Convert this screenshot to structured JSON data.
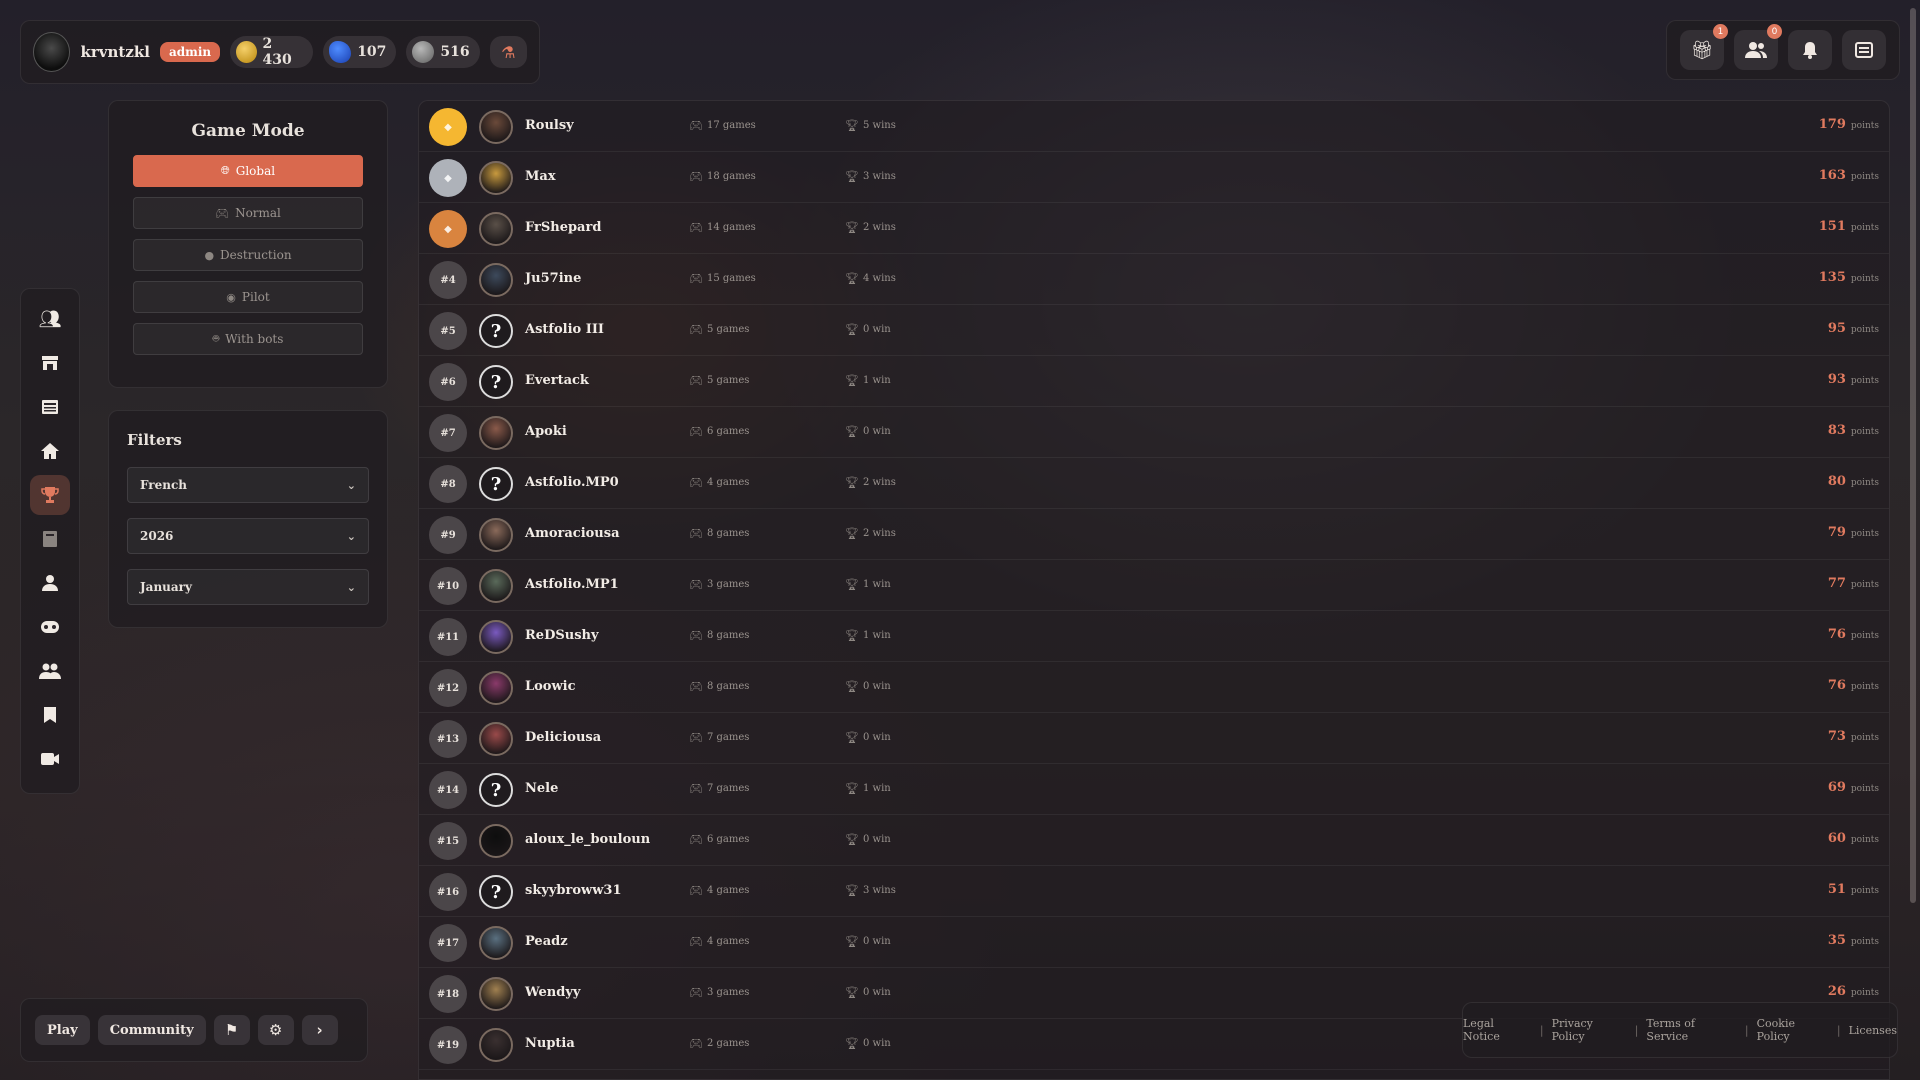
{
  "user": {
    "name": "krvntzkl",
    "role": "admin",
    "gold": "2 430",
    "gems": "107",
    "silver": "516"
  },
  "topright": {
    "gift_badge": "1",
    "friends_badge": "0"
  },
  "sidebar": {
    "items": [
      "friends-icon",
      "shop-icon",
      "news-icon",
      "home-icon",
      "trophy-icon",
      "book-icon",
      "user-icon",
      "gamepad-icon",
      "group-icon",
      "bookmark-icon",
      "video-icon"
    ],
    "active": "trophy-icon"
  },
  "game_mode": {
    "title": "Game Mode",
    "options": [
      "Global",
      "Normal",
      "Destruction",
      "Pilot",
      "With bots"
    ],
    "selected": "Global"
  },
  "filters": {
    "title": "Filters",
    "language": "French",
    "year": "2026",
    "month": "January"
  },
  "leaderboard": [
    {
      "rank": "",
      "name": "Roulsy",
      "games": "17 games",
      "wins": "5 wins",
      "points": "179"
    },
    {
      "rank": "",
      "name": "Max",
      "games": "18 games",
      "wins": "3 wins",
      "points": "163"
    },
    {
      "rank": "",
      "name": "FrShepard",
      "games": "14 games",
      "wins": "2 wins",
      "points": "151"
    },
    {
      "rank": "#4",
      "name": "Ju57ine",
      "games": "15 games",
      "wins": "4 wins",
      "points": "135"
    },
    {
      "rank": "#5",
      "name": "Astfolio III",
      "games": "5 games",
      "wins": "0 win",
      "points": "95"
    },
    {
      "rank": "#6",
      "name": "Evertack",
      "games": "5 games",
      "wins": "1 win",
      "points": "93"
    },
    {
      "rank": "#7",
      "name": "Apoki",
      "games": "6 games",
      "wins": "0 win",
      "points": "83"
    },
    {
      "rank": "#8",
      "name": "Astfolio.MP0",
      "games": "4 games",
      "wins": "2 wins",
      "points": "80"
    },
    {
      "rank": "#9",
      "name": "Amoraciousa",
      "games": "8 games",
      "wins": "2 wins",
      "points": "79"
    },
    {
      "rank": "#10",
      "name": "Astfolio.MP1",
      "games": "3 games",
      "wins": "1 win",
      "points": "77"
    },
    {
      "rank": "#11",
      "name": "ReDSushy",
      "games": "8 games",
      "wins": "1 win",
      "points": "76"
    },
    {
      "rank": "#12",
      "name": "Loowic",
      "games": "8 games",
      "wins": "0 win",
      "points": "76"
    },
    {
      "rank": "#13",
      "name": "Deliciousa",
      "games": "7 games",
      "wins": "0 win",
      "points": "73"
    },
    {
      "rank": "#14",
      "name": "Nele",
      "games": "7 games",
      "wins": "1 win",
      "points": "69"
    },
    {
      "rank": "#15",
      "name": "aloux_le_bouloun",
      "games": "6 games",
      "wins": "0 win",
      "points": "60"
    },
    {
      "rank": "#16",
      "name": "skyybroww31",
      "games": "4 games",
      "wins": "3 wins",
      "points": "51"
    },
    {
      "rank": "#17",
      "name": "Peadz",
      "games": "4 games",
      "wins": "0 win",
      "points": "35"
    },
    {
      "rank": "#18",
      "name": "Wendyy",
      "games": "3 games",
      "wins": "0 win",
      "points": "26"
    },
    {
      "rank": "#19",
      "name": "Nuptia",
      "games": "2 games",
      "wins": "0 win",
      "points": ""
    }
  ],
  "points_unit": "points",
  "bottom": {
    "play": "Play",
    "community": "Community"
  },
  "legal": {
    "links": [
      "Legal Notice",
      "Privacy Policy",
      "Terms of Service",
      "Cookie Policy",
      "Licenses"
    ]
  }
}
